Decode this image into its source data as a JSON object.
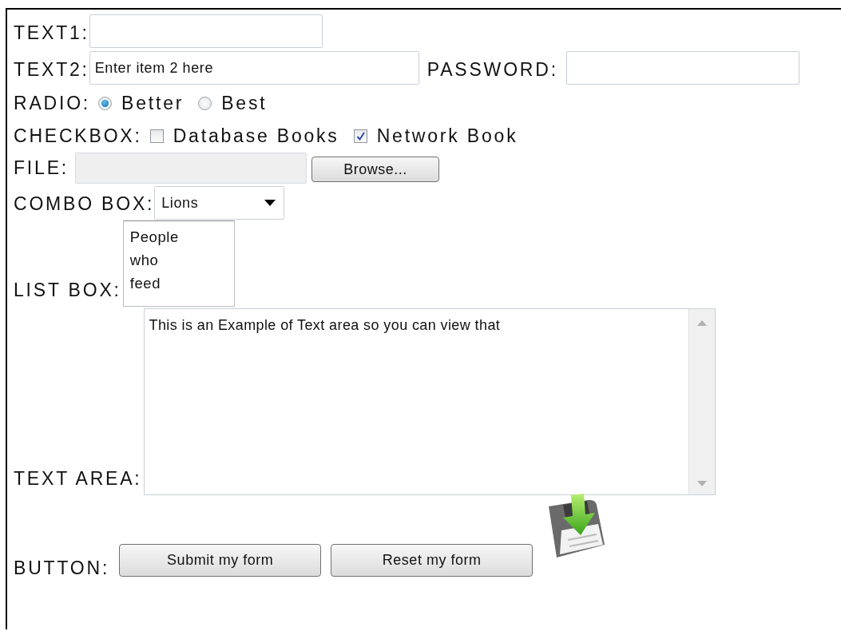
{
  "rows": [
    {
      "label": "TEXT1:",
      "controls": [
        {
          "kind": "text"
        }
      ]
    },
    {
      "label": "TEXT2:",
      "controls": [
        {
          "kind": "text",
          "value": "Enter item 2 here"
        },
        {
          "kind": "label",
          "text": "PASSWORD:"
        },
        {
          "kind": "password"
        }
      ]
    },
    {
      "label": "RADIO:",
      "controls": [
        {
          "kind": "radio",
          "label": "Better",
          "selected": true
        },
        {
          "kind": "radio",
          "label": "Best",
          "selected": false
        }
      ]
    },
    {
      "label": "CHECKBOX:",
      "controls": [
        {
          "kind": "checkbox",
          "label": "Database Books",
          "checked": false
        },
        {
          "kind": "checkbox",
          "label": "Network Book",
          "checked": true
        }
      ]
    },
    {
      "label": "FILE:",
      "controls": [
        {
          "kind": "file",
          "button": "Browse..."
        }
      ]
    },
    {
      "label": "COMBO BOX:",
      "controls": [
        {
          "kind": "select",
          "value": "Lions"
        }
      ]
    },
    {
      "label": "LIST BOX:",
      "controls": [
        {
          "kind": "list",
          "items": [
            "People",
            "who",
            "feed"
          ]
        }
      ]
    },
    {
      "label": "TEXT AREA:",
      "controls": [
        {
          "kind": "textarea",
          "value": "This is an Example of Text area so you can view that"
        }
      ]
    },
    {
      "label": "BUTTON:",
      "controls": [
        {
          "kind": "button",
          "label": "Submit my form"
        },
        {
          "kind": "button",
          "label": "Reset my form"
        },
        {
          "kind": "icon"
        }
      ]
    }
  ]
}
